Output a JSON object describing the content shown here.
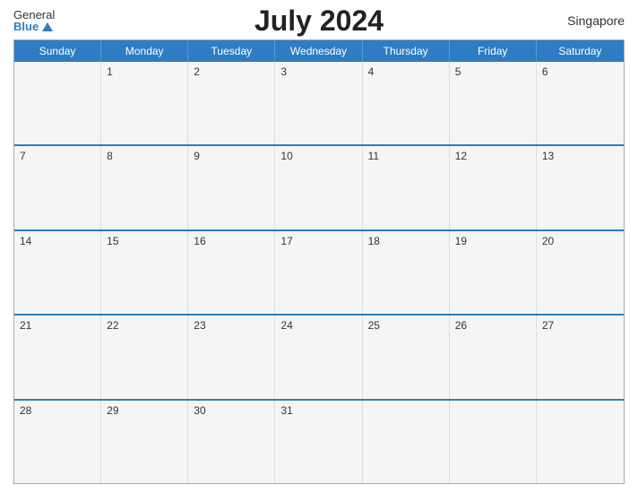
{
  "header": {
    "logo_general": "General",
    "logo_blue": "Blue",
    "title": "July 2024",
    "location": "Singapore"
  },
  "calendar": {
    "days_of_week": [
      "Sunday",
      "Monday",
      "Tuesday",
      "Wednesday",
      "Thursday",
      "Friday",
      "Saturday"
    ],
    "weeks": [
      [
        null,
        1,
        2,
        3,
        4,
        5,
        6
      ],
      [
        7,
        8,
        9,
        10,
        11,
        12,
        13
      ],
      [
        14,
        15,
        16,
        17,
        18,
        19,
        20
      ],
      [
        21,
        22,
        23,
        24,
        25,
        26,
        27
      ],
      [
        28,
        29,
        30,
        31,
        null,
        null,
        null
      ]
    ]
  }
}
